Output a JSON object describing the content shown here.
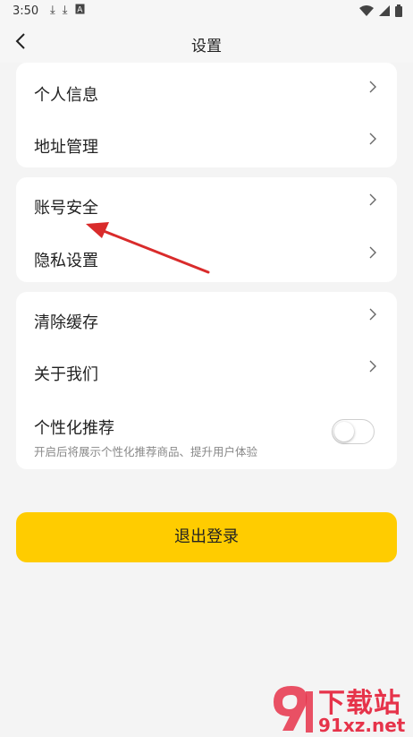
{
  "status_bar": {
    "time": "3:50",
    "left_icons": [
      "download-icon",
      "download-icon",
      "a-icon"
    ],
    "right_icons": [
      "wifi-icon",
      "signal-icon",
      "battery-icon"
    ]
  },
  "nav": {
    "title": "设置",
    "back_icon": "chevron-left-icon"
  },
  "card1": {
    "items": [
      {
        "label": "个人信息"
      },
      {
        "label": "地址管理"
      }
    ]
  },
  "card2": {
    "items": [
      {
        "label": "账号安全"
      },
      {
        "label": "隐私设置"
      }
    ]
  },
  "card3": {
    "items": [
      {
        "label": "清除缓存"
      },
      {
        "label": "关于我们"
      }
    ],
    "recommend": {
      "label": "个性化推荐",
      "description": "开启后将展示个性化推荐商品、提升用户体验",
      "enabled": false
    }
  },
  "logout": {
    "label": "退出登录"
  },
  "annotation": {
    "color": "#d92b2b",
    "points_to": "账号安全"
  },
  "watermark": {
    "name": "下载站",
    "site": "91xz.net",
    "color": "#e6334a"
  },
  "colors": {
    "accent": "#ffcc00",
    "background": "#f4f4f4",
    "card": "#ffffff"
  }
}
